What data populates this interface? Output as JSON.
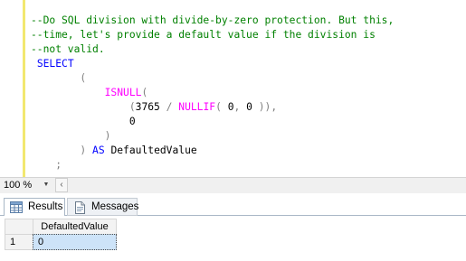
{
  "editor": {
    "lines": [
      [
        {
          "c": "cm",
          "t": "--Do SQL division with divide-by-zero protection. But this,"
        }
      ],
      [
        {
          "c": "cm",
          "t": "--time, let's provide a default value if the division is"
        }
      ],
      [
        {
          "c": "cm",
          "t": "--not valid."
        }
      ],
      [
        {
          "c": "txt",
          "t": " "
        },
        {
          "c": "kw",
          "t": "SELECT"
        }
      ],
      [
        {
          "c": "txt",
          "t": "        "
        },
        {
          "c": "op",
          "t": "("
        }
      ],
      [
        {
          "c": "txt",
          "t": "            "
        },
        {
          "c": "fn",
          "t": "ISNULL"
        },
        {
          "c": "op",
          "t": "("
        }
      ],
      [
        {
          "c": "txt",
          "t": "                "
        },
        {
          "c": "op",
          "t": "("
        },
        {
          "c": "txt",
          "t": "3765 "
        },
        {
          "c": "op",
          "t": "/"
        },
        {
          "c": "txt",
          "t": " "
        },
        {
          "c": "fn",
          "t": "NULLIF"
        },
        {
          "c": "op",
          "t": "("
        },
        {
          "c": "txt",
          "t": " 0"
        },
        {
          "c": "op",
          "t": ","
        },
        {
          "c": "txt",
          "t": " 0 "
        },
        {
          "c": "op",
          "t": ")),"
        }
      ],
      [
        {
          "c": "txt",
          "t": "                0"
        }
      ],
      [
        {
          "c": "txt",
          "t": "            "
        },
        {
          "c": "op",
          "t": ")"
        }
      ],
      [
        {
          "c": "txt",
          "t": "        "
        },
        {
          "c": "op",
          "t": ")"
        },
        {
          "c": "txt",
          "t": " "
        },
        {
          "c": "kw",
          "t": "AS"
        },
        {
          "c": "txt",
          "t": " DefaultedValue"
        }
      ],
      [
        {
          "c": "dim",
          "t": "    ;"
        }
      ]
    ],
    "margin_color": "#f2e86f"
  },
  "zoom": {
    "value": "100 %",
    "dropdown_icon": "dropdown-arrow-icon",
    "scroll_left_icon": "scroll-left-arrow-icon"
  },
  "tabs": {
    "results_label": "Results",
    "messages_label": "Messages",
    "results_icon": "grid-icon",
    "messages_icon": "message-page-icon"
  },
  "grid": {
    "columns": [
      "DefaultedValue"
    ],
    "rows": [
      {
        "num": "1",
        "cells": [
          "0"
        ]
      }
    ],
    "selected_color": "#cde3f8"
  }
}
